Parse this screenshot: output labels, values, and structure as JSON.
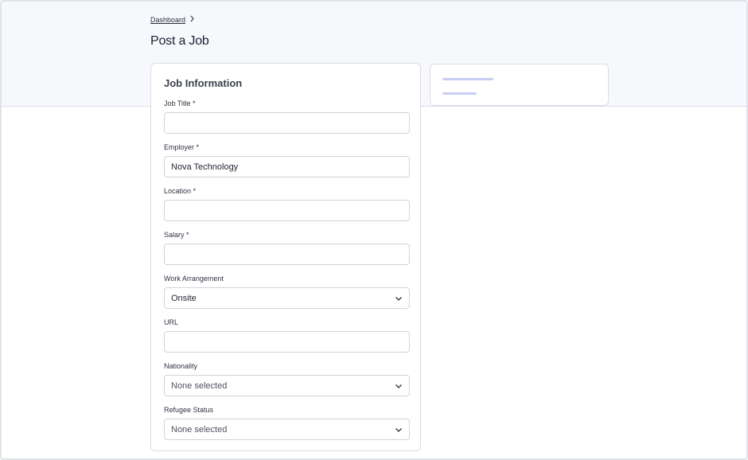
{
  "breadcrumb": {
    "items": [
      "Dashboard"
    ]
  },
  "page": {
    "title": "Post a Job"
  },
  "form": {
    "section_title": "Job Information",
    "fields": {
      "job_title": {
        "label": "Job Title *",
        "value": ""
      },
      "employer": {
        "label": "Employer *",
        "value": "Nova Technology"
      },
      "location": {
        "label": "Location *",
        "value": ""
      },
      "salary": {
        "label": "Salary *",
        "value": ""
      },
      "work_arrangement": {
        "label": "Work Arrangement",
        "value": "Onsite"
      },
      "url": {
        "label": "URL",
        "value": ""
      },
      "nationality": {
        "label": "Nationality",
        "value": "None selected"
      },
      "refugee_status": {
        "label": "Refugee Status",
        "value": "None selected"
      }
    }
  },
  "icons": {
    "breadcrumb_separator": "chevron-right-icon",
    "dropdown": "chevron-down-icon"
  },
  "colors": {
    "accent_skeleton": "#c8cdf3",
    "band_background": "#f7f8fc"
  }
}
